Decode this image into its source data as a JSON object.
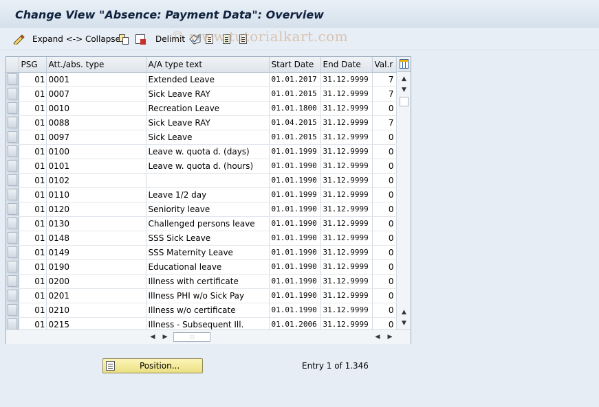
{
  "title": "Change View \"Absence: Payment Data\": Overview",
  "toolbar": {
    "expand_collapse": "Expand <-> Collapse",
    "delimit": "Delimit",
    "icons": [
      "edit-glasses-icon",
      "copy-icon",
      "delete-icon",
      "delimit-icon",
      "select-all-icon",
      "select-block-icon",
      "deselect-all-icon"
    ]
  },
  "watermark": "© www.tutorialkart.com",
  "table": {
    "columns": [
      "PSG",
      "Att./abs. type",
      "A/A type text",
      "Start Date",
      "End Date",
      "Val.r"
    ],
    "rows": [
      {
        "psg": "01",
        "type": "0001",
        "text": "Extended Leave",
        "start": "01.01.2017",
        "end": "31.12.9999",
        "val": "7"
      },
      {
        "psg": "01",
        "type": "0007",
        "text": "Sick Leave RAY",
        "start": "01.01.2015",
        "end": "31.12.9999",
        "val": "7"
      },
      {
        "psg": "01",
        "type": "0010",
        "text": "Recreation Leave",
        "start": "01.01.1800",
        "end": "31.12.9999",
        "val": "0"
      },
      {
        "psg": "01",
        "type": "0088",
        "text": "Sick Leave RAY",
        "start": "01.04.2015",
        "end": "31.12.9999",
        "val": "7"
      },
      {
        "psg": "01",
        "type": "0097",
        "text": "Sick Leave",
        "start": "01.01.2015",
        "end": "31.12.9999",
        "val": "0"
      },
      {
        "psg": "01",
        "type": "0100",
        "text": "Leave w. quota d. (days)",
        "start": "01.01.1999",
        "end": "31.12.9999",
        "val": "0"
      },
      {
        "psg": "01",
        "type": "0101",
        "text": "Leave w. quota d. (hours)",
        "start": "01.01.1990",
        "end": "31.12.9999",
        "val": "0"
      },
      {
        "psg": "01",
        "type": "0102",
        "text": "",
        "start": "01.01.1990",
        "end": "31.12.9999",
        "val": "0"
      },
      {
        "psg": "01",
        "type": "0110",
        "text": "Leave 1/2 day",
        "start": "01.01.1999",
        "end": "31.12.9999",
        "val": "0"
      },
      {
        "psg": "01",
        "type": "0120",
        "text": "Seniority leave",
        "start": "01.01.1990",
        "end": "31.12.9999",
        "val": "0"
      },
      {
        "psg": "01",
        "type": "0130",
        "text": "Challenged persons leave",
        "start": "01.01.1990",
        "end": "31.12.9999",
        "val": "0"
      },
      {
        "psg": "01",
        "type": "0148",
        "text": "SSS Sick Leave",
        "start": "01.01.1990",
        "end": "31.12.9999",
        "val": "0"
      },
      {
        "psg": "01",
        "type": "0149",
        "text": "SSS Maternity Leave",
        "start": "01.01.1990",
        "end": "31.12.9999",
        "val": "0"
      },
      {
        "psg": "01",
        "type": "0190",
        "text": "Educational leave",
        "start": "01.01.1990",
        "end": "31.12.9999",
        "val": "0"
      },
      {
        "psg": "01",
        "type": "0200",
        "text": "Illness with certificate",
        "start": "01.01.1990",
        "end": "31.12.9999",
        "val": "0"
      },
      {
        "psg": "01",
        "type": "0201",
        "text": "Illness PHI w/o Sick Pay",
        "start": "01.01.1990",
        "end": "31.12.9999",
        "val": "0"
      },
      {
        "psg": "01",
        "type": "0210",
        "text": "Illness w/o certificate",
        "start": "01.01.1990",
        "end": "31.12.9999",
        "val": "0"
      },
      {
        "psg": "01",
        "type": "0215",
        "text": "Illness - Subsequent Ill.",
        "start": "01.01.2006",
        "end": "31.12.9999",
        "val": "0"
      }
    ]
  },
  "position_button": "Position...",
  "entry_info": "Entry 1 of 1.346",
  "colors": {
    "title_text": "#10223e",
    "position_button": "#f4ea9c",
    "watermark": "#c8a078"
  }
}
